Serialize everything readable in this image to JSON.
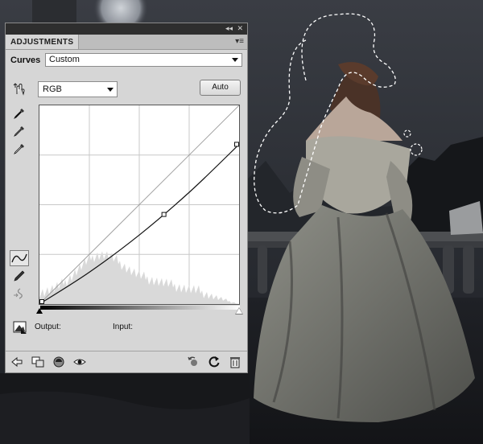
{
  "panel": {
    "tab_label": "ADJUSTMENTS",
    "adjustment_name": "Curves",
    "preset": {
      "selected": "Custom"
    },
    "channel": {
      "selected": "RGB"
    },
    "auto_button_label": "Auto",
    "output_label": "Output:",
    "input_label": "Input:"
  },
  "icons": {
    "topbar": [
      "collapse-arrows-icon",
      "panel-close-icon"
    ],
    "left_tools": [
      "on-image-adjust-hand-icon",
      "black-point-eyedropper-icon",
      "gray-point-eyedropper-icon",
      "white-point-eyedropper-icon",
      "curve-points-icon",
      "pencil-icon",
      "smooth-icon"
    ],
    "bottom": [
      "return-to-list-icon",
      "clip-to-layer-icon",
      "layer-visibility-icon",
      "eye-icon",
      "previous-state-icon",
      "reset-icon",
      "delete-icon"
    ]
  },
  "chart_data": {
    "type": "line",
    "xlim": [
      0,
      255
    ],
    "ylim": [
      0,
      255
    ],
    "grid": "4x4",
    "series": [
      {
        "values": [
          [
            0,
            0
          ],
          [
            64,
            41
          ],
          [
            128,
            89
          ],
          [
            192,
            144
          ],
          [
            255,
            205
          ]
        ]
      }
    ],
    "control_points": [
      [
        0,
        0
      ],
      [
        159,
        115
      ],
      [
        255,
        205
      ]
    ],
    "baseline": [
      [
        0,
        0
      ],
      [
        255,
        255
      ]
    ],
    "histogram": true
  }
}
